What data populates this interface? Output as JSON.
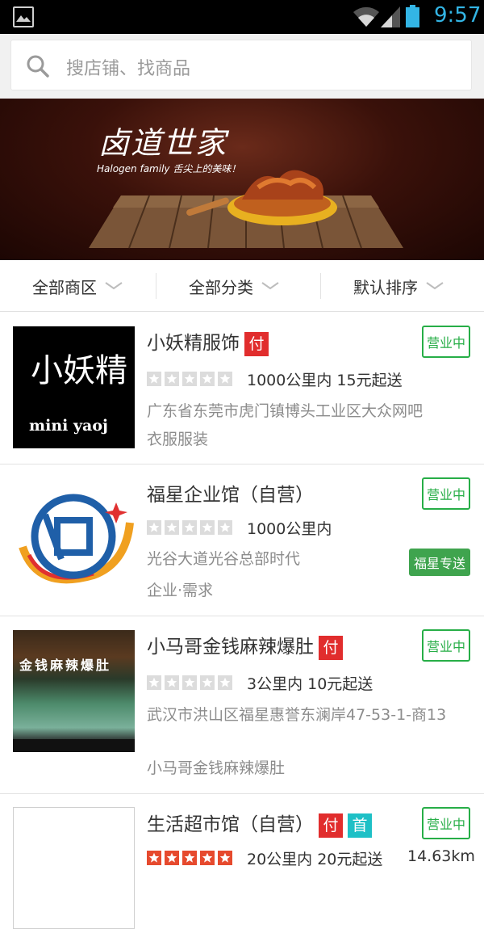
{
  "status_bar": {
    "time": "9:57",
    "icons": [
      "image-icon",
      "wifi-icon",
      "signal-icon",
      "battery-icon"
    ]
  },
  "search": {
    "placeholder": "搜店铺、找商品"
  },
  "banner": {
    "brand": "卤道世家",
    "tagline": "Halogen family  舌尖上的美味！"
  },
  "filters": [
    {
      "label": "全部商区"
    },
    {
      "label": "全部分类"
    },
    {
      "label": "默认排序"
    }
  ],
  "shops": [
    {
      "name": "小妖精服饰",
      "tags": [
        "付"
      ],
      "rating": 0,
      "delivery": "1000公里内 15元起送",
      "address": "广东省东莞市虎门镇博头工业区大众网吧",
      "category": "衣服服装",
      "status": "营业中",
      "logo_text": "小妖精",
      "logo_sub": "mini yaoj"
    },
    {
      "name": "福星企业馆（自营）",
      "tags": [],
      "rating": 0,
      "delivery": "1000公里内",
      "address": "光谷大道光谷总部时代",
      "category": "企业·需求",
      "status": "营业中",
      "express": "福星专送"
    },
    {
      "name": "小马哥金钱麻辣爆肚",
      "tags": [
        "付"
      ],
      "rating": 0,
      "delivery": "3公里内 10元起送",
      "address": "武汉市洪山区福星惠誉东澜岸47-53-1-商13",
      "category": "小马哥金钱麻辣爆肚",
      "status": "营业中",
      "sign_text": "金钱麻辣爆肚"
    },
    {
      "name": "生活超市馆（自营）",
      "tags": [
        "付",
        "首"
      ],
      "rating": 5,
      "delivery": "20公里内 20元起送",
      "distance": "14.63km",
      "status": "营业中"
    }
  ],
  "colors": {
    "accent_green": "#27ae47",
    "pay_red": "#e12d2d",
    "first_teal": "#1ec0c6",
    "time_blue": "#33b5e5"
  }
}
